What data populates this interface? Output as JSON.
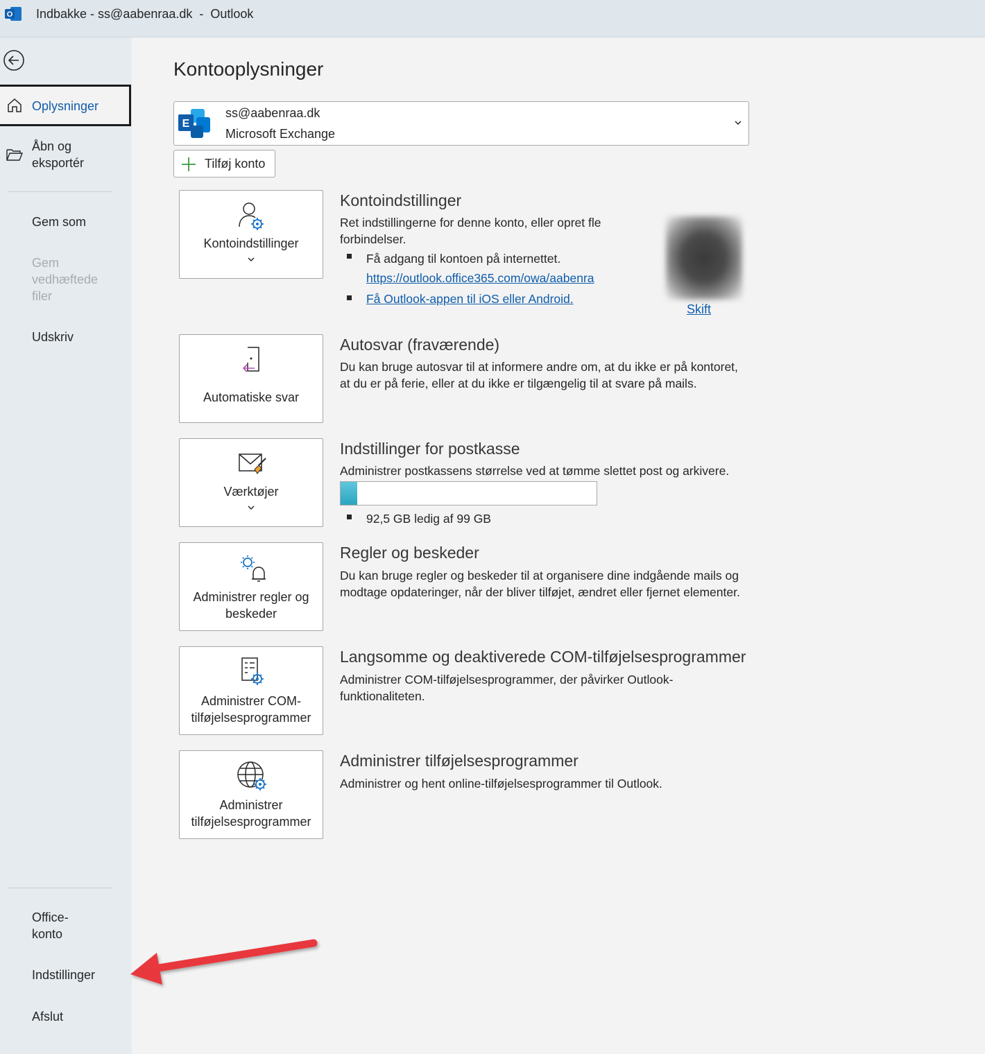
{
  "window": {
    "title": "Indbakke - ss@aabenraa.dk  -  Outlook"
  },
  "sidebar": {
    "items": [
      {
        "label": "Oplysninger"
      },
      {
        "label": "Åbn og eksportér"
      },
      {
        "label": "Gem som"
      },
      {
        "label": "Gem vedhæftede filer"
      },
      {
        "label": "Udskriv"
      },
      {
        "label": "Office-konto"
      },
      {
        "label": "Indstillinger"
      },
      {
        "label": "Afslut"
      }
    ]
  },
  "main": {
    "title": "Kontooplysninger",
    "account": {
      "email": "ss@aabenraa.dk",
      "type": "Microsoft Exchange"
    },
    "add_account_label": "Tilføj konto",
    "sections": [
      {
        "tile_label": "Kontoindstillinger",
        "title": "Kontoindstillinger",
        "text": "Ret indstillingerne for denne konto, eller opret fle",
        "text2": "forbindelser.",
        "bullets": [
          "Få adgang til kontoen på internettet.",
          "https://outlook.office365.com/owa/aabenra",
          "Få Outlook-appen til iOS eller Android."
        ],
        "photo_link": "Skift"
      },
      {
        "tile_label": "Automatiske svar",
        "title": "Autosvar (fraværende)",
        "text": "Du kan bruge autosvar til at informere andre om, at du ikke er på kontoret, at du er på ferie, eller at du ikke er tilgængelig til at svare på mails."
      },
      {
        "tile_label": "Værktøjer",
        "title": "Indstillinger for postkasse",
        "text": "Administrer postkassens størrelse ved at tømme slettet post og arkivere.",
        "storage_free_fraction": 0.066,
        "storage_text": "92,5 GB ledig af 99 GB"
      },
      {
        "tile_label": "Administrer regler og beskeder",
        "title": "Regler og beskeder",
        "text": "Du kan bruge regler og beskeder til at organisere dine indgående mails og modtage opdateringer, når der bliver tilføjet, ændret eller fjernet elementer."
      },
      {
        "tile_label": "Administrer COM-tilføjelsesprogrammer",
        "title": "Langsomme og deaktiverede COM-tilføjelsesprogrammer",
        "text": "Administrer COM-tilføjelsesprogrammer, der påvirker Outlook-funktionaliteten."
      },
      {
        "tile_label": "Administrer tilføjelsesprogrammer",
        "title": "Administrer tilføjelsesprogrammer",
        "text": "Administrer og hent online-tilføjelsesprogrammer til Outlook."
      }
    ]
  },
  "colors": {
    "accent": "#0f5dab",
    "arrow": "#e8383d",
    "storage": "#2aa5c0"
  }
}
